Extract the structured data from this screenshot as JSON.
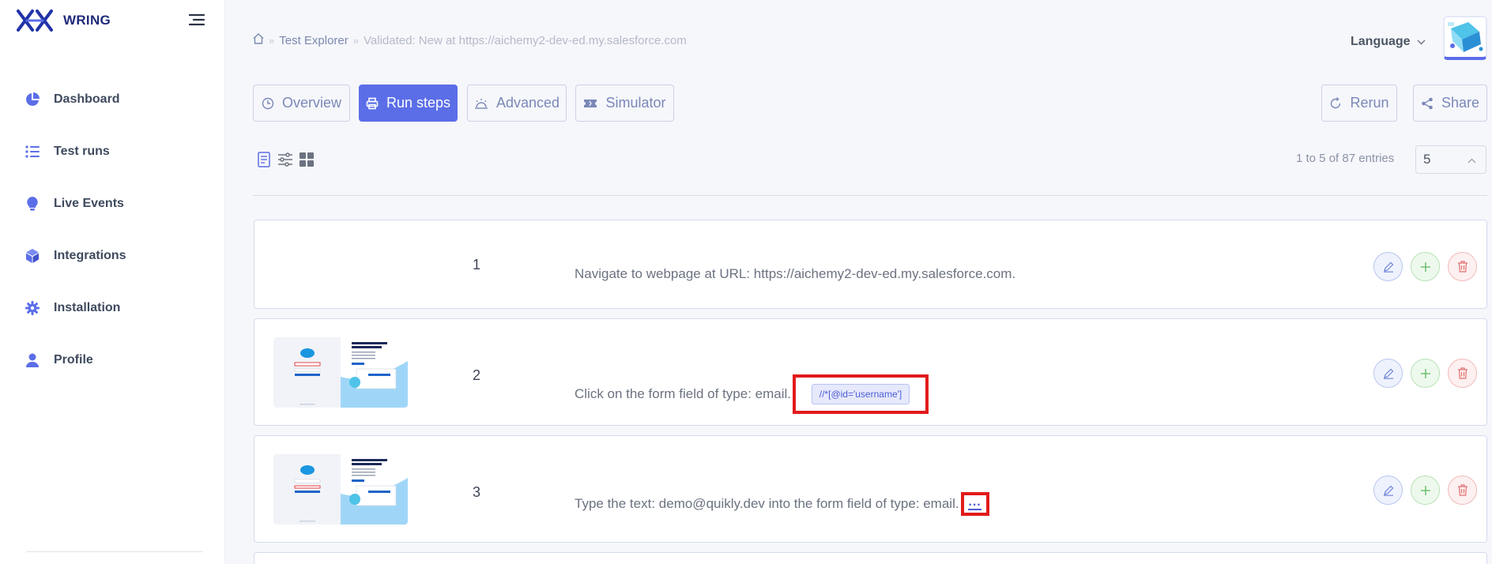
{
  "brand": {
    "name": "WRING"
  },
  "sidebar": {
    "items": [
      {
        "label": "Dashboard",
        "icon": "pie-chart-icon"
      },
      {
        "label": "Test runs",
        "icon": "list-icon"
      },
      {
        "label": "Live Events",
        "icon": "lightbulb-icon"
      },
      {
        "label": "Integrations",
        "icon": "cube-icon"
      },
      {
        "label": "Installation",
        "icon": "gear-icon"
      },
      {
        "label": "Profile",
        "icon": "user-icon"
      }
    ]
  },
  "breadcrumb": {
    "items": [
      "Test Explorer",
      "Validated: New at https://aichemy2-dev-ed.my.salesforce.com"
    ]
  },
  "header": {
    "language_label": "Language"
  },
  "tabs": [
    {
      "label": "Overview",
      "icon": "clock-icon",
      "active": false
    },
    {
      "label": "Run steps",
      "icon": "printer-icon",
      "active": true
    },
    {
      "label": "Advanced",
      "icon": "alarm-icon",
      "active": false
    },
    {
      "label": "Simulator",
      "icon": "ticket-icon",
      "active": false
    }
  ],
  "actions": {
    "rerun_label": "Rerun",
    "share_label": "Share"
  },
  "list": {
    "entries_text": "1 to 5 of 87 entries",
    "page_size": "5"
  },
  "steps": [
    {
      "number": "1",
      "text": "Navigate to webpage at URL: https://aichemy2-dev-ed.my.salesforce.com.",
      "has_thumbnail": false
    },
    {
      "number": "2",
      "text": "Click on the form field of type: email.",
      "selector": "//*[@id='username']",
      "has_thumbnail": true
    },
    {
      "number": "3",
      "text": "Type the text: demo@quikly.dev into the form field of type: email.",
      "more": "...",
      "has_thumbnail": true
    }
  ],
  "colors": {
    "accent": "#5b6ee8",
    "brand": "#1f2a7a",
    "highlight": "#e21b1b"
  }
}
